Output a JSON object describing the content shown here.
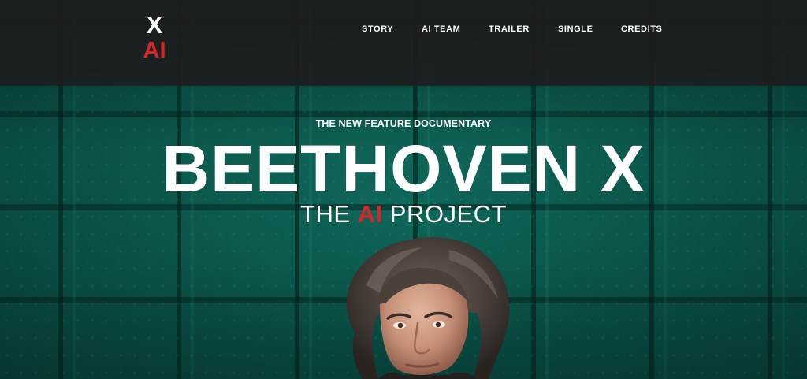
{
  "header": {
    "logo_top": "X",
    "logo_bottom": "AI",
    "nav": [
      {
        "label": "STORY"
      },
      {
        "label": "AI TEAM"
      },
      {
        "label": "TRAILER"
      },
      {
        "label": "SINGLE"
      },
      {
        "label": "CREDITS"
      }
    ]
  },
  "hero": {
    "kicker": "THE NEW FEATURE DOCUMENTARY",
    "title": "BEETHOVEN X",
    "subtitle_before": "THE",
    "subtitle_accent": "AI",
    "subtitle_after": "PROJECT"
  },
  "colors": {
    "accent": "#d9252a",
    "header_bg": "#1c1e1e",
    "background": "#0c5a4e"
  }
}
